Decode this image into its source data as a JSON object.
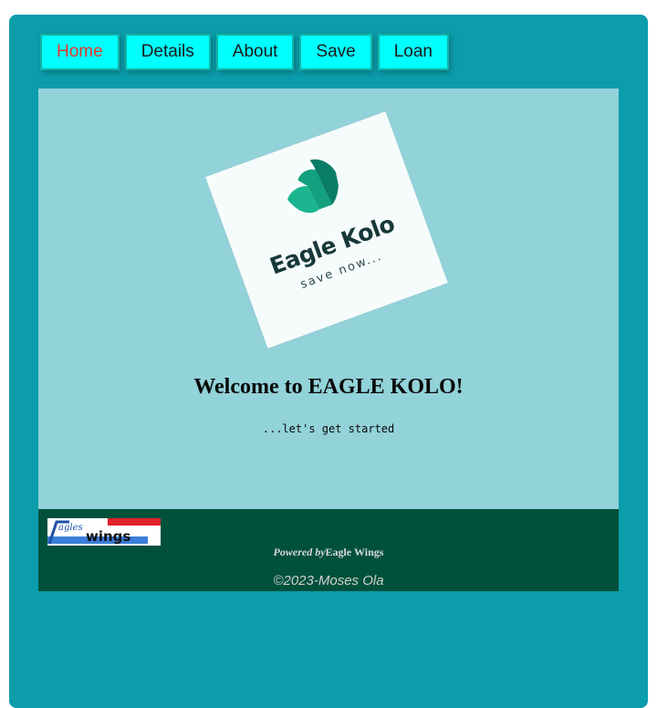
{
  "nav": {
    "items": [
      {
        "label": "Home",
        "active": true
      },
      {
        "label": "Details",
        "active": false
      },
      {
        "label": "About",
        "active": false
      },
      {
        "label": "Save",
        "active": false
      },
      {
        "label": "Loan",
        "active": false
      }
    ]
  },
  "hero": {
    "logo_title": "Eagle Kolo",
    "logo_tagline": "save now...",
    "welcome": "Welcome to EAGLE KOLO!",
    "tagline": "...let's get started"
  },
  "footer": {
    "logo_text": "Eagles Wings",
    "powered_prefix": "Powered by",
    "powered_name": "Eagle Wings",
    "copyright": "©2023-Moses Ola"
  },
  "colors": {
    "app_background": "#0b9dab",
    "nav_button": "#00ffff",
    "active_nav_text": "#e8342a",
    "content_background": "#92d2d9",
    "footer_background": "#00513b",
    "logo_green": "#1bb58f"
  }
}
